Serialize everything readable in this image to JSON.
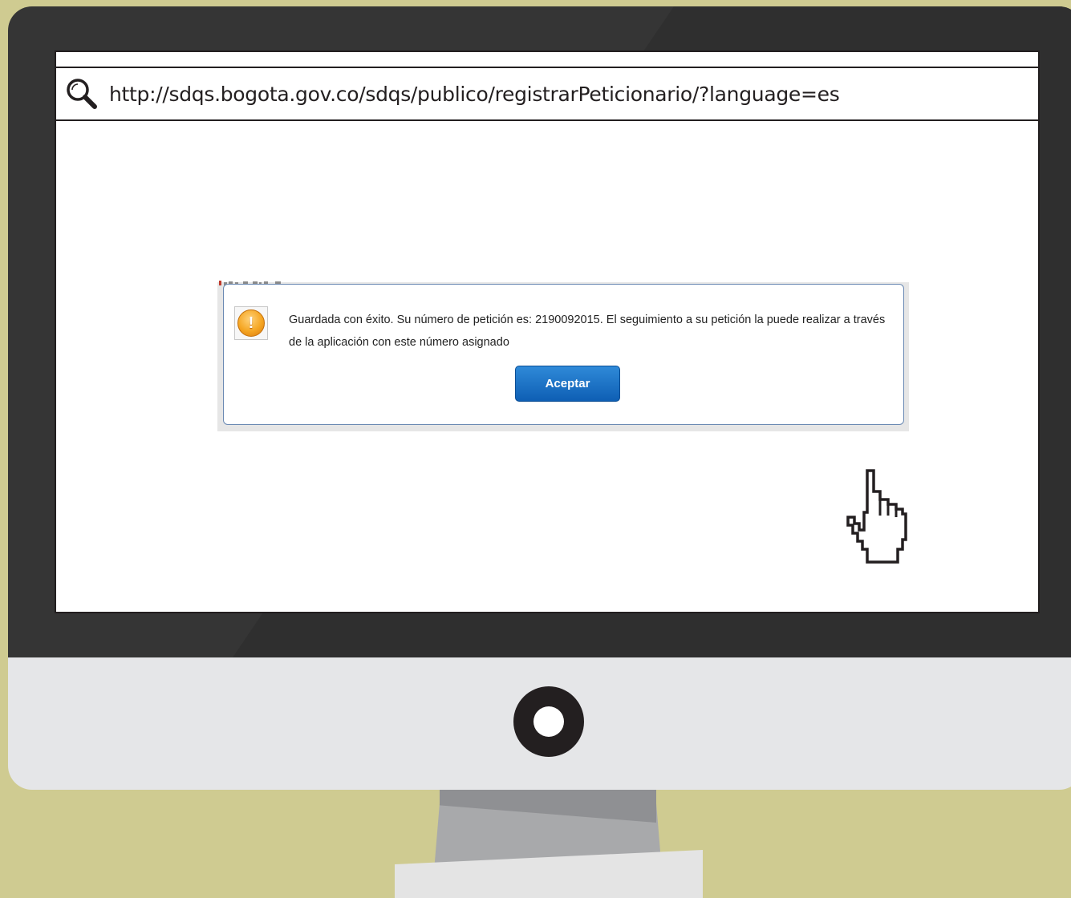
{
  "browser": {
    "url": "http://sdqs.bogota.gov.co/sdqs/publico/registrarPeticionario/?language=es"
  },
  "dialog": {
    "message": "Guardada con éxito. Su número de petición es: 2190092015. El seguimiento a su petición la puede realizar a través de la aplicación con este número asignado",
    "accept_label": "Aceptar",
    "icon": "warning-icon"
  },
  "cursor": {
    "icon": "hand-pointer-icon"
  },
  "colors": {
    "background": "#cfcb91",
    "bezel": "#353535",
    "chin": "#e5e6e8",
    "accent_button": "#1a6fc4",
    "warning": "#f5a623"
  }
}
